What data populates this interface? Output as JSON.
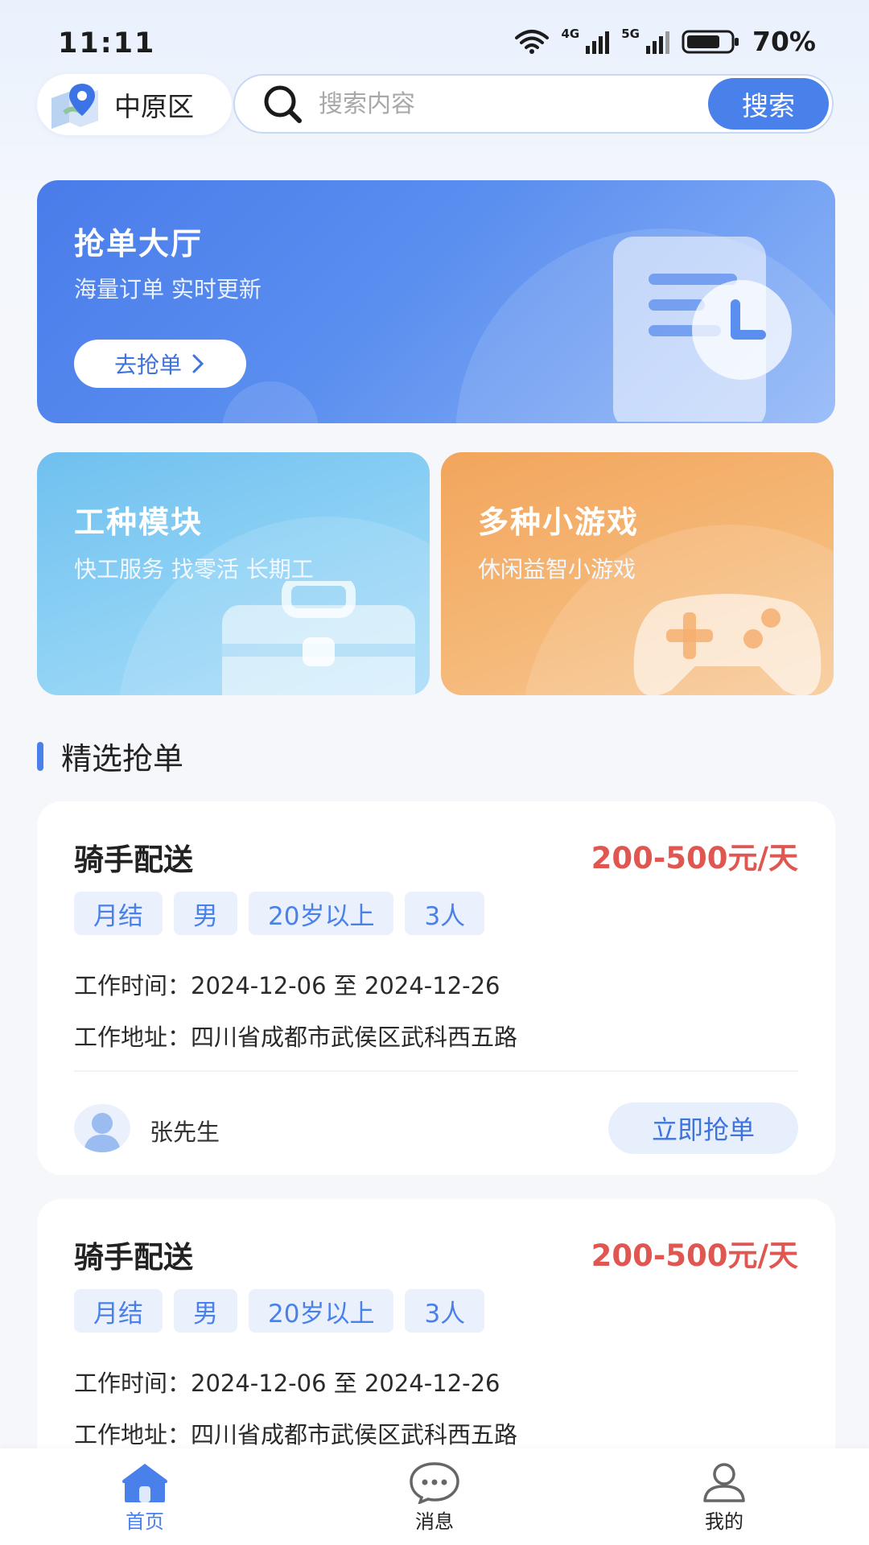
{
  "status_bar": {
    "time": "11:11",
    "network_4g": "4G",
    "network_5g": "5G",
    "battery": "70%"
  },
  "location": {
    "label": "中原区"
  },
  "search": {
    "placeholder": "搜索内容",
    "button_label": "搜索"
  },
  "banner": {
    "title": "抢单大厅",
    "subtitle": "海量订单 实时更新",
    "button_label": "去抢单"
  },
  "features": [
    {
      "title": "工种模块",
      "subtitle": "快工服务 找零活 长期工"
    },
    {
      "title": "多种小游戏",
      "subtitle": "休闲益智小游戏"
    }
  ],
  "section": {
    "title": "精选抢单"
  },
  "jobs": [
    {
      "title": "骑手配送",
      "salary": "200-500元/天",
      "tags": [
        "月结",
        "男",
        "20岁以上",
        "3人"
      ],
      "time": "工作时间：2024-12-06 至 2024-12-26",
      "address": "工作地址：四川省成都市武侯区武科西五路",
      "poster": "张先生",
      "button_label": "立即抢单"
    },
    {
      "title": "骑手配送",
      "salary": "200-500元/天",
      "tags": [
        "月结",
        "男",
        "20岁以上",
        "3人"
      ],
      "time": "工作时间：2024-12-06 至 2024-12-26",
      "address": "工作地址：四川省成都市武侯区武科西五路"
    }
  ],
  "nav": {
    "items": [
      {
        "label": "首页",
        "icon": "home-icon",
        "active": true
      },
      {
        "label": "消息",
        "icon": "message-icon",
        "active": false
      },
      {
        "label": "我的",
        "icon": "profile-icon",
        "active": false
      }
    ]
  },
  "colors": {
    "accent": "#4a80ea",
    "salary": "#e05752",
    "card_blue": "#6fc0ef",
    "card_orange": "#f2a55c"
  }
}
